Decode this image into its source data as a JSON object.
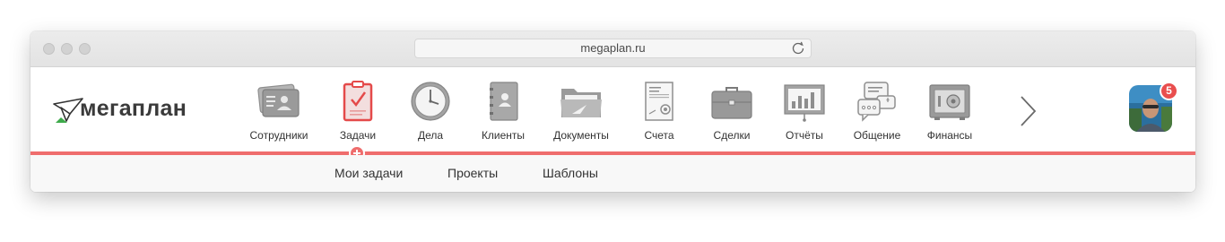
{
  "browser": {
    "url": "megaplan.ru",
    "buttons": [
      "close-button",
      "minimize-button",
      "zoom-button"
    ]
  },
  "app": {
    "logo_text": "мегаплан"
  },
  "nav": {
    "items": [
      {
        "label": "Сотрудники",
        "icon": "employees-icon"
      },
      {
        "label": "Задачи",
        "icon": "tasks-clipboard-icon",
        "active": true
      },
      {
        "label": "Дела",
        "icon": "clock-icon"
      },
      {
        "label": "Клиенты",
        "icon": "contacts-book-icon"
      },
      {
        "label": "Документы",
        "icon": "folder-icon"
      },
      {
        "label": "Счета",
        "icon": "invoice-icon"
      },
      {
        "label": "Сделки",
        "icon": "briefcase-icon"
      },
      {
        "label": "Отчёты",
        "icon": "chart-board-icon"
      },
      {
        "label": "Общение",
        "icon": "chat-bubbles-icon"
      },
      {
        "label": "Финансы",
        "icon": "safe-icon"
      }
    ],
    "next_icon": "chevron-right-icon"
  },
  "user": {
    "notifications_count": "5"
  },
  "subnav": {
    "items": [
      "Мои задачи",
      "Проекты",
      "Шаблоны"
    ]
  },
  "colors": {
    "accent": "#ef6d6d",
    "badge": "#e94e4e",
    "icon_gray": "#8e8e8e",
    "logo_green": "#3daa4a"
  }
}
